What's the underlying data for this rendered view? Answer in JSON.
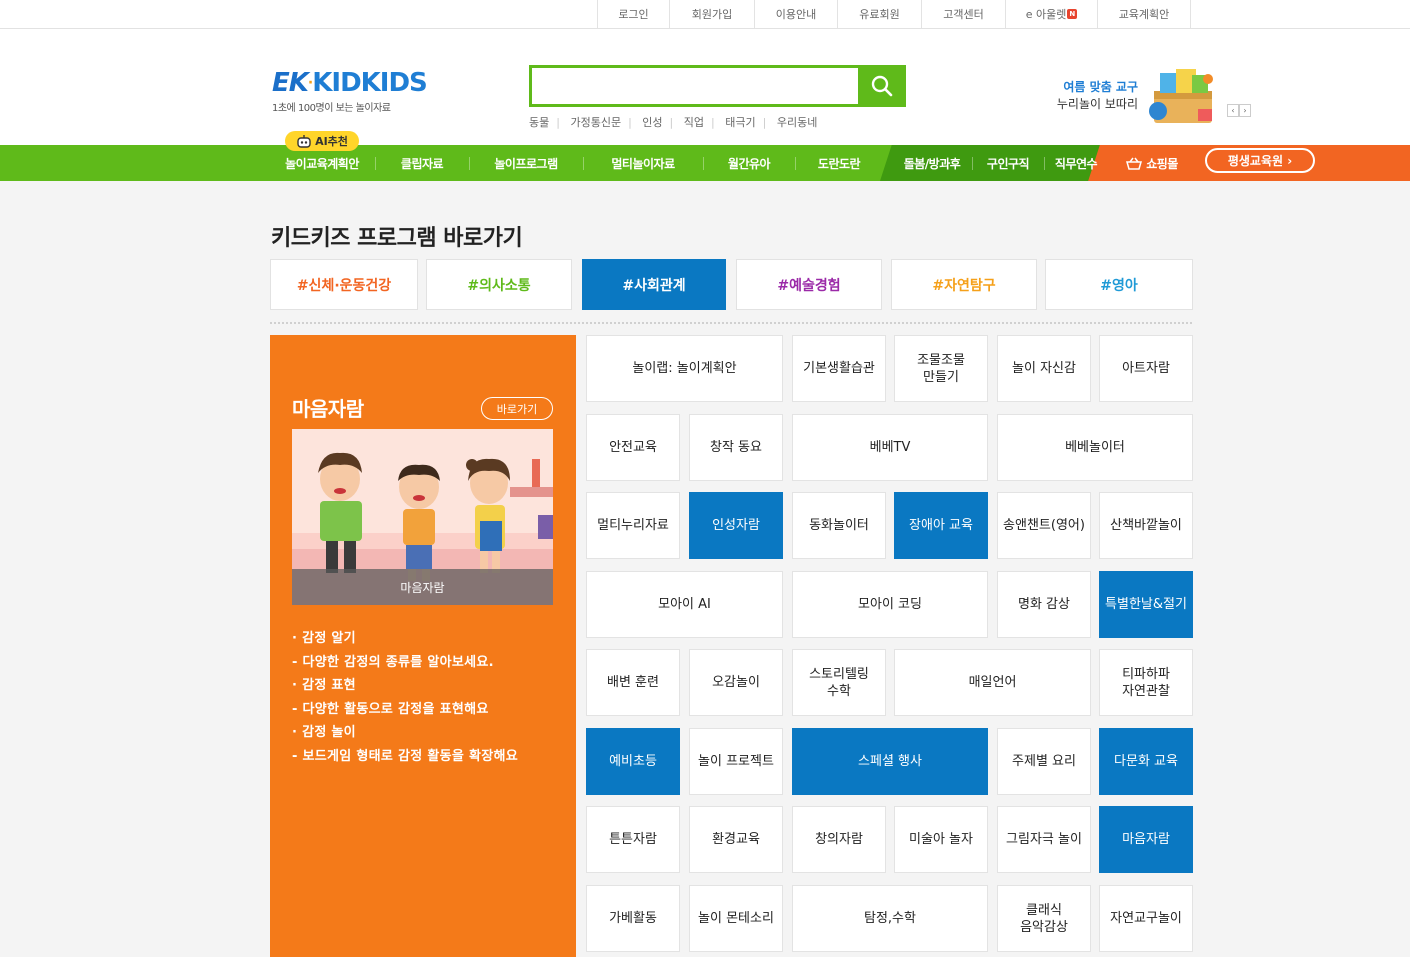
{
  "util_menu": [
    "로그인",
    "회원가입",
    "이용안내",
    "유료회원",
    "고객센터",
    "e 아울렛",
    "교육계획안"
  ],
  "util_badge": "N",
  "logo": {
    "main_ek": "EK",
    "main_kid": "KIDKIDS",
    "sub": "1초에 100명이 보는 놀이자료"
  },
  "search": {
    "placeholder": "",
    "value": ""
  },
  "keywords": [
    "동물",
    "가정통신문",
    "인성",
    "직업",
    "태극기",
    "우리동네"
  ],
  "promo": {
    "line1": "여름 맞춤 교구",
    "line2": "누리놀이 보따리",
    "prev": "‹",
    "next": "›"
  },
  "ai_badge": "AI추천",
  "gnb": [
    "놀이교육계획안",
    "클립자료",
    "놀이프로그램",
    "멀티놀이자료",
    "월간유아",
    "도란도란",
    "돌봄/방과후",
    "구인구직",
    "직무연수",
    "쇼핑몰"
  ],
  "edu_button": "평생교육원 ›",
  "section_title": {
    "light": "키드키즈",
    "bold": "프로그램 바로가기"
  },
  "categories": [
    {
      "label": "#신체·운동건강",
      "color": "#f26522"
    },
    {
      "label": "#의사소통",
      "color": "#5fba1a"
    },
    {
      "label": "#사회관계",
      "color": "#ffffff"
    },
    {
      "label": "#예술경험",
      "color": "#9b2aa8"
    },
    {
      "label": "#자연탐구",
      "color": "#f5a01a"
    },
    {
      "label": "#영아",
      "color": "#1f9ad6"
    }
  ],
  "panel": {
    "title": "마음자람",
    "link": "바로가기",
    "image_caption": "마음자람",
    "desc": [
      "· 감정 알기",
      "- 다양한 감정의 종류를 알아보세요.",
      "· 감정 표현",
      "- 다양한 활동으로 감정을 표현해요",
      "· 감정 놀이",
      "- 보드게임 형태로 감정 활동을 확장해요"
    ]
  },
  "programs": [
    "놀이랩: 놀이계획안",
    "기본생활습관",
    "조물조물\n만들기",
    "놀이 자신감",
    "아트자람",
    "안전교육",
    "창작 동요",
    "베베TV",
    "베베놀이터",
    "멀티누리자료",
    "인성자람",
    "동화놀이터",
    "장애아 교육",
    "송앤챈트(영어)",
    "산책바깥놀이",
    "모아이 AI",
    "모아이 코딩",
    "명화 감상",
    "특별한날&절기",
    "배변 훈련",
    "오감놀이",
    "스토리텔링\n수학",
    "매일언어",
    "티파하파\n자연관찰",
    "예비초등",
    "놀이 프로젝트",
    "스페셜 행사",
    "주제별 요리",
    "다문화 교육",
    "튼튼자람",
    "환경교육",
    "창의자람",
    "미술아 놀자",
    "그림자극 놀이",
    "마음자람",
    "가베활동",
    "놀이 몬테소리",
    "탐정,수학",
    "클래식\n음악감상",
    "자연교구놀이"
  ]
}
